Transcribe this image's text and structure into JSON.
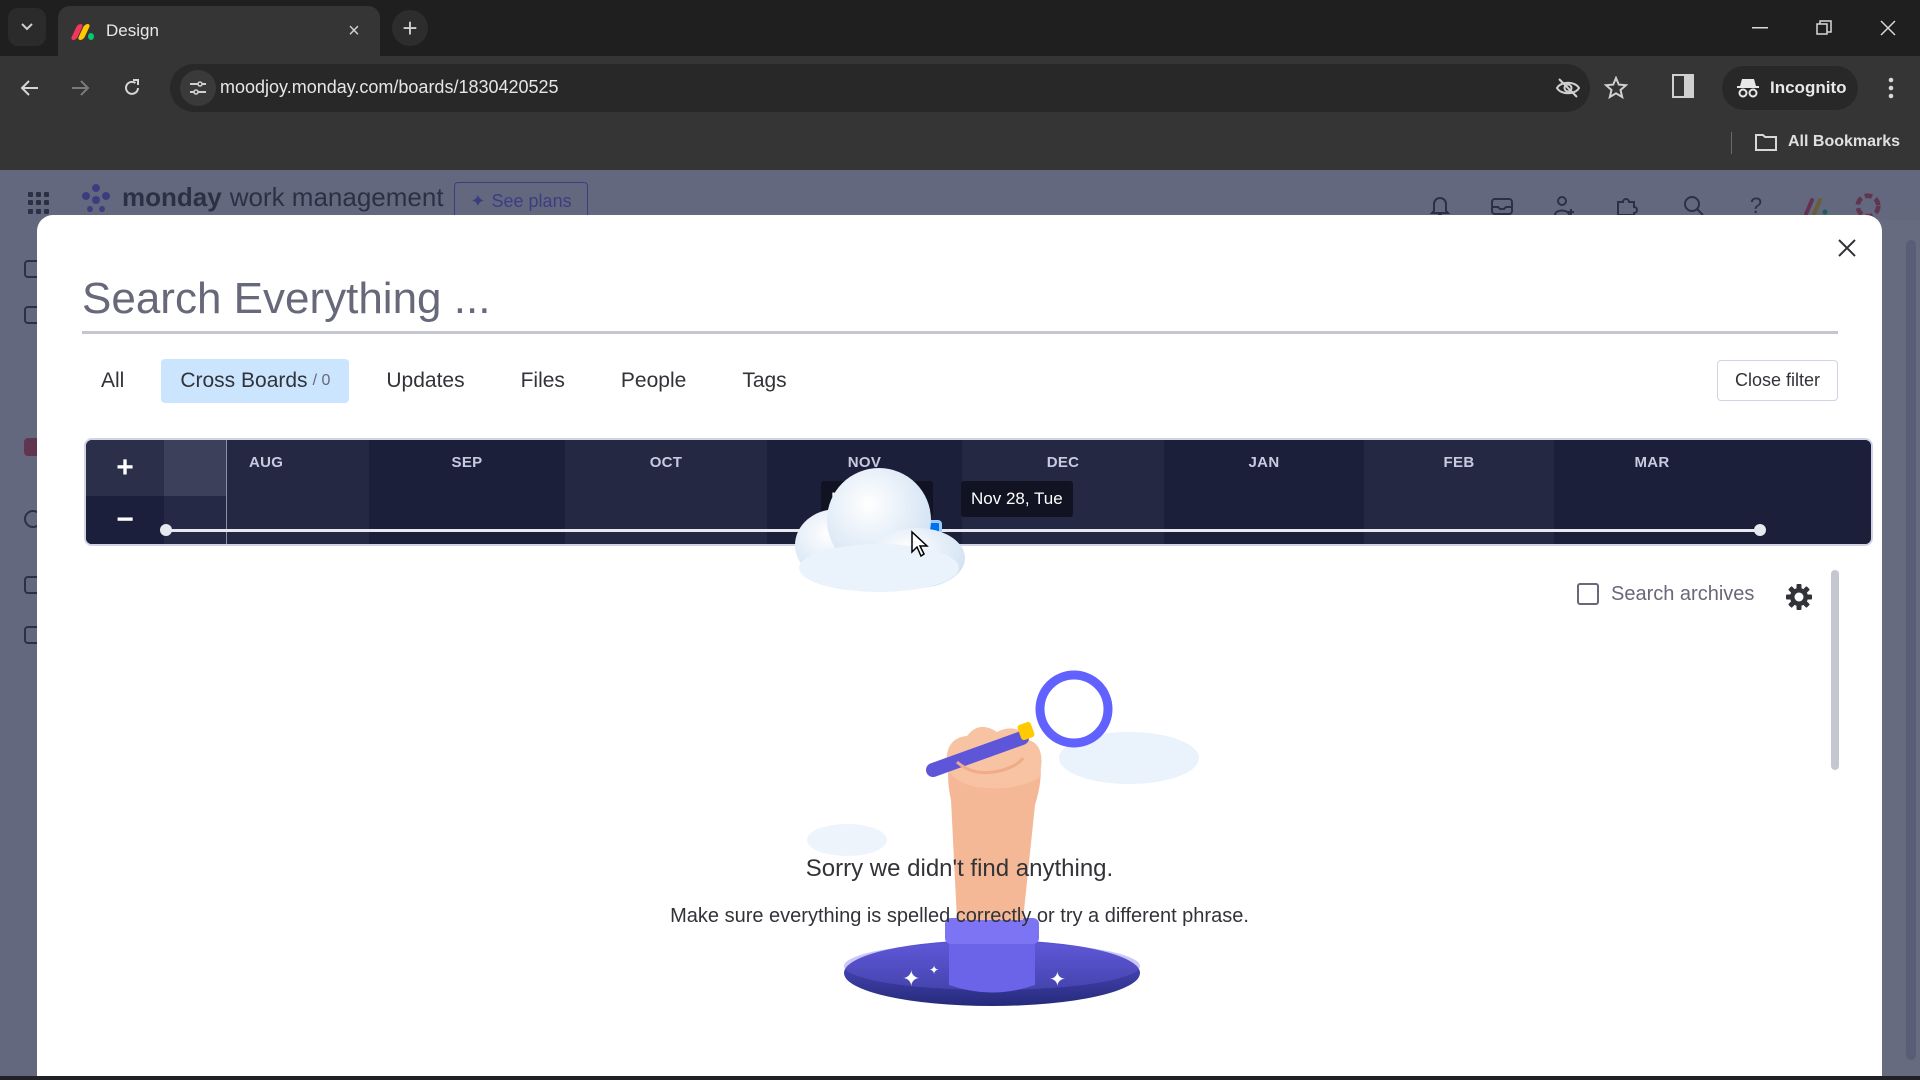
{
  "browser": {
    "tab": {
      "title": "Design",
      "close_label": "×"
    },
    "new_tab_label": "+",
    "url": "moodjoy.monday.com/boards/1830420525",
    "incognito_label": "Incognito",
    "bookmarks_label": "All Bookmarks",
    "window_controls": [
      "minimize",
      "restore",
      "close"
    ]
  },
  "app": {
    "brand": "monday",
    "product": "work management",
    "see_plans_label": "See plans",
    "header_icons": [
      "bell-icon",
      "inbox-icon",
      "invite-icon",
      "apps-icon",
      "search-icon",
      "help-icon"
    ]
  },
  "search_modal": {
    "placeholder": "Search Everything ...",
    "value": "",
    "tabs": [
      {
        "label": "All",
        "active": false
      },
      {
        "label": "Cross Boards",
        "count": "/ 0",
        "active": true
      },
      {
        "label": "Updates",
        "active": false
      },
      {
        "label": "Files",
        "active": false
      },
      {
        "label": "People",
        "active": false
      },
      {
        "label": "Tags",
        "active": false
      }
    ],
    "close_filter_label": "Close filter",
    "timeline": {
      "zoom_in_label": "+",
      "zoom_out_label": "−",
      "months": [
        "AUG",
        "SEP",
        "OCT",
        "NOV",
        "DEC",
        "JAN",
        "FEB",
        "MAR"
      ],
      "range_start_label": "Nov 21, Tue",
      "range_end_label": "Nov 28, Tue"
    },
    "search_archives_label": "Search archives",
    "search_archives_checked": false,
    "empty_title": "Sorry we didn't find anything.",
    "empty_subtitle": "Make sure everything is spelled correctly or try a different phrase."
  },
  "colors": {
    "accent": "#0073ea",
    "active_tab_bg": "#cce5ff",
    "timeline_bg": "#1e2140",
    "illustration_purple": "#6161ff"
  }
}
